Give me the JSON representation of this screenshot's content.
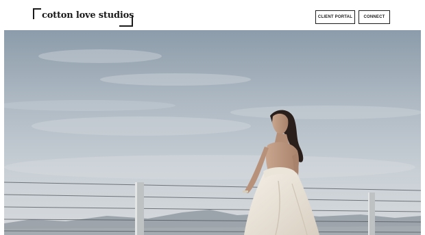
{
  "brand": {
    "name": "cotton love studios"
  },
  "nav": {
    "client_portal": "CLIENT PORTAL",
    "connect": "CONNECT"
  },
  "hero": {
    "image": "bride-on-rooftop-photo",
    "dominant_color": "#b7c2cc"
  },
  "colors": {
    "text": "#1a1a1a",
    "background": "#ffffff"
  }
}
